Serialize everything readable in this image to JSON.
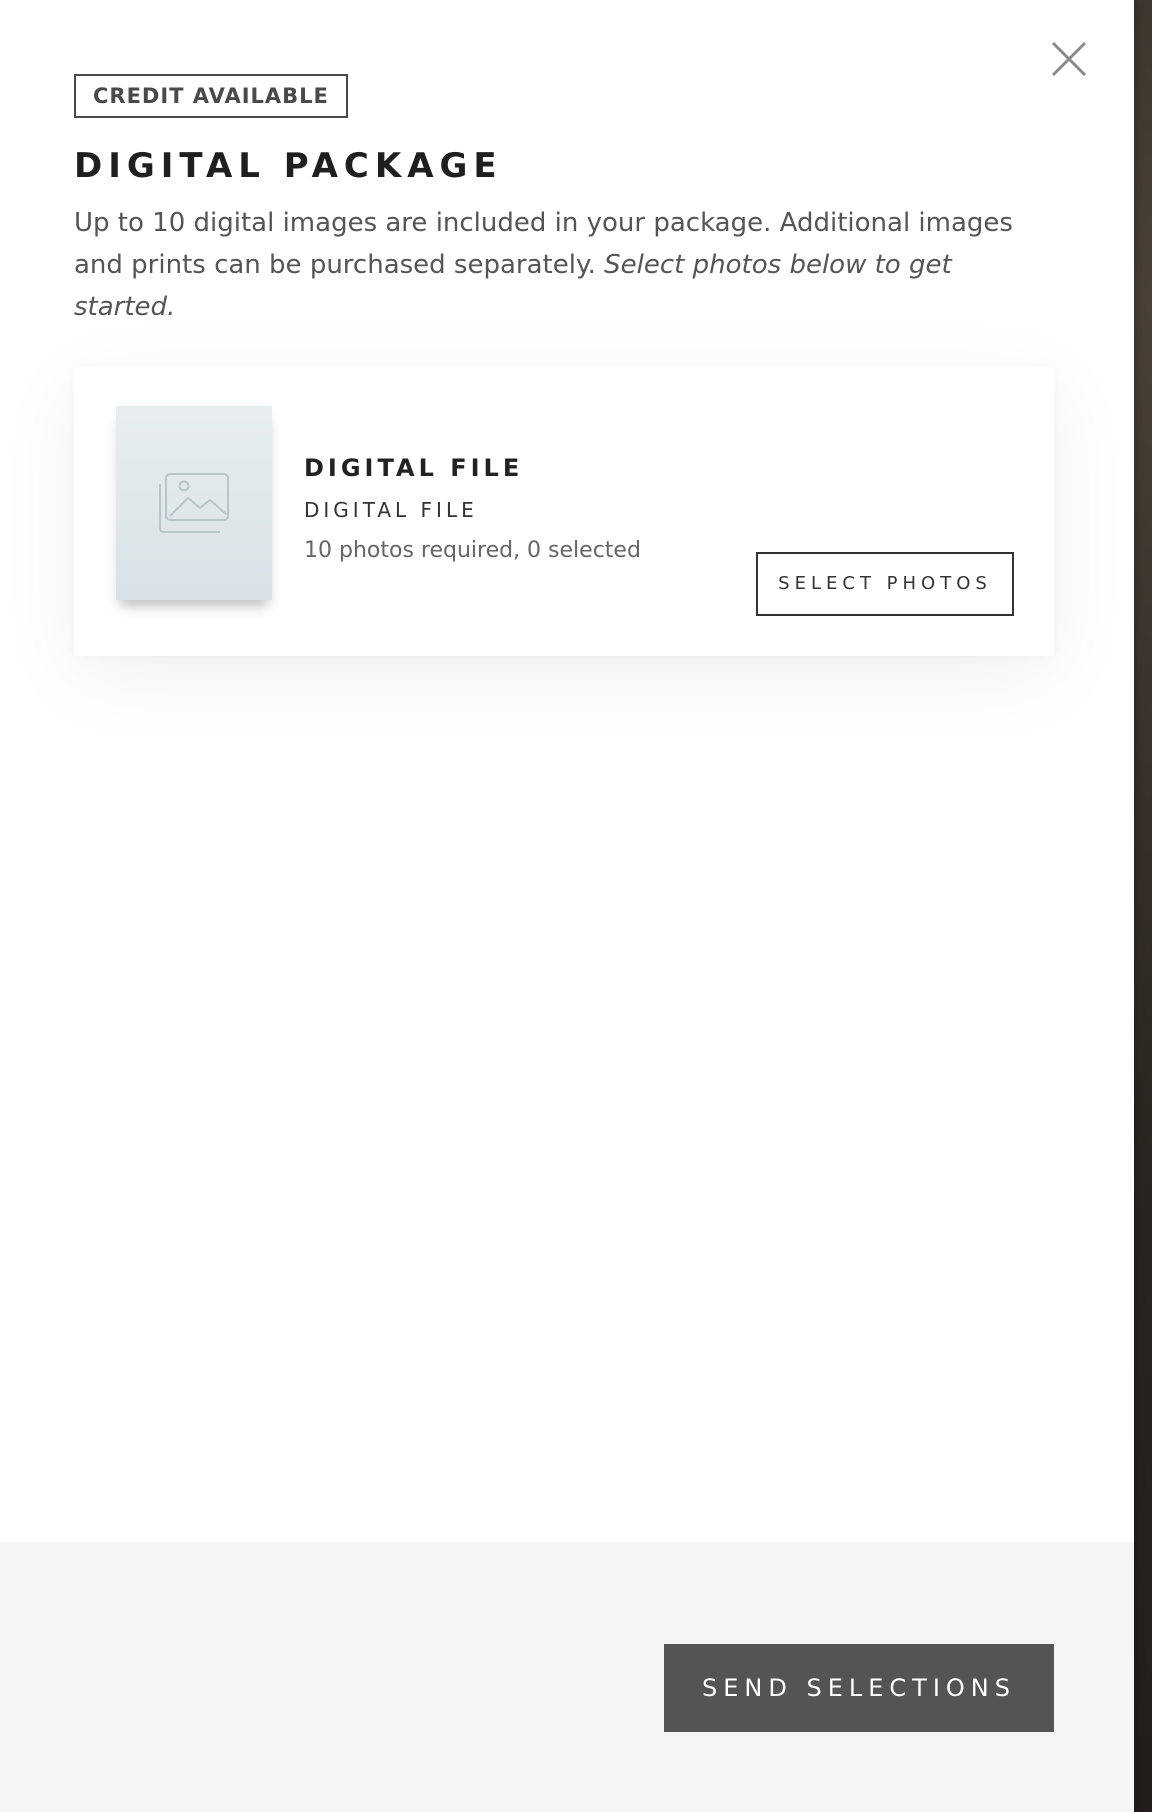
{
  "modal": {
    "badge": "CREDIT AVAILABLE",
    "title": "DIGITAL PACKAGE",
    "description": "Up to 10 digital images are included in your package. Additional images and prints can be purchased separately.",
    "description_emphasis": "Select photos below to get started."
  },
  "item": {
    "title": "DIGITAL FILE",
    "subtitle": "DIGITAL FILE",
    "meta": "10 photos required, 0 selected",
    "select_label": "SELECT PHOTOS",
    "thumbnail_icon": "image-placeholder-icon"
  },
  "footer": {
    "send_label": "SEND SELECTIONS"
  },
  "colors": {
    "panel_bg": "#ffffff",
    "footer_bg": "#f5f5f5",
    "primary_button_bg": "#545454",
    "text_dark": "#1f1f1f",
    "text_muted": "#555555"
  }
}
